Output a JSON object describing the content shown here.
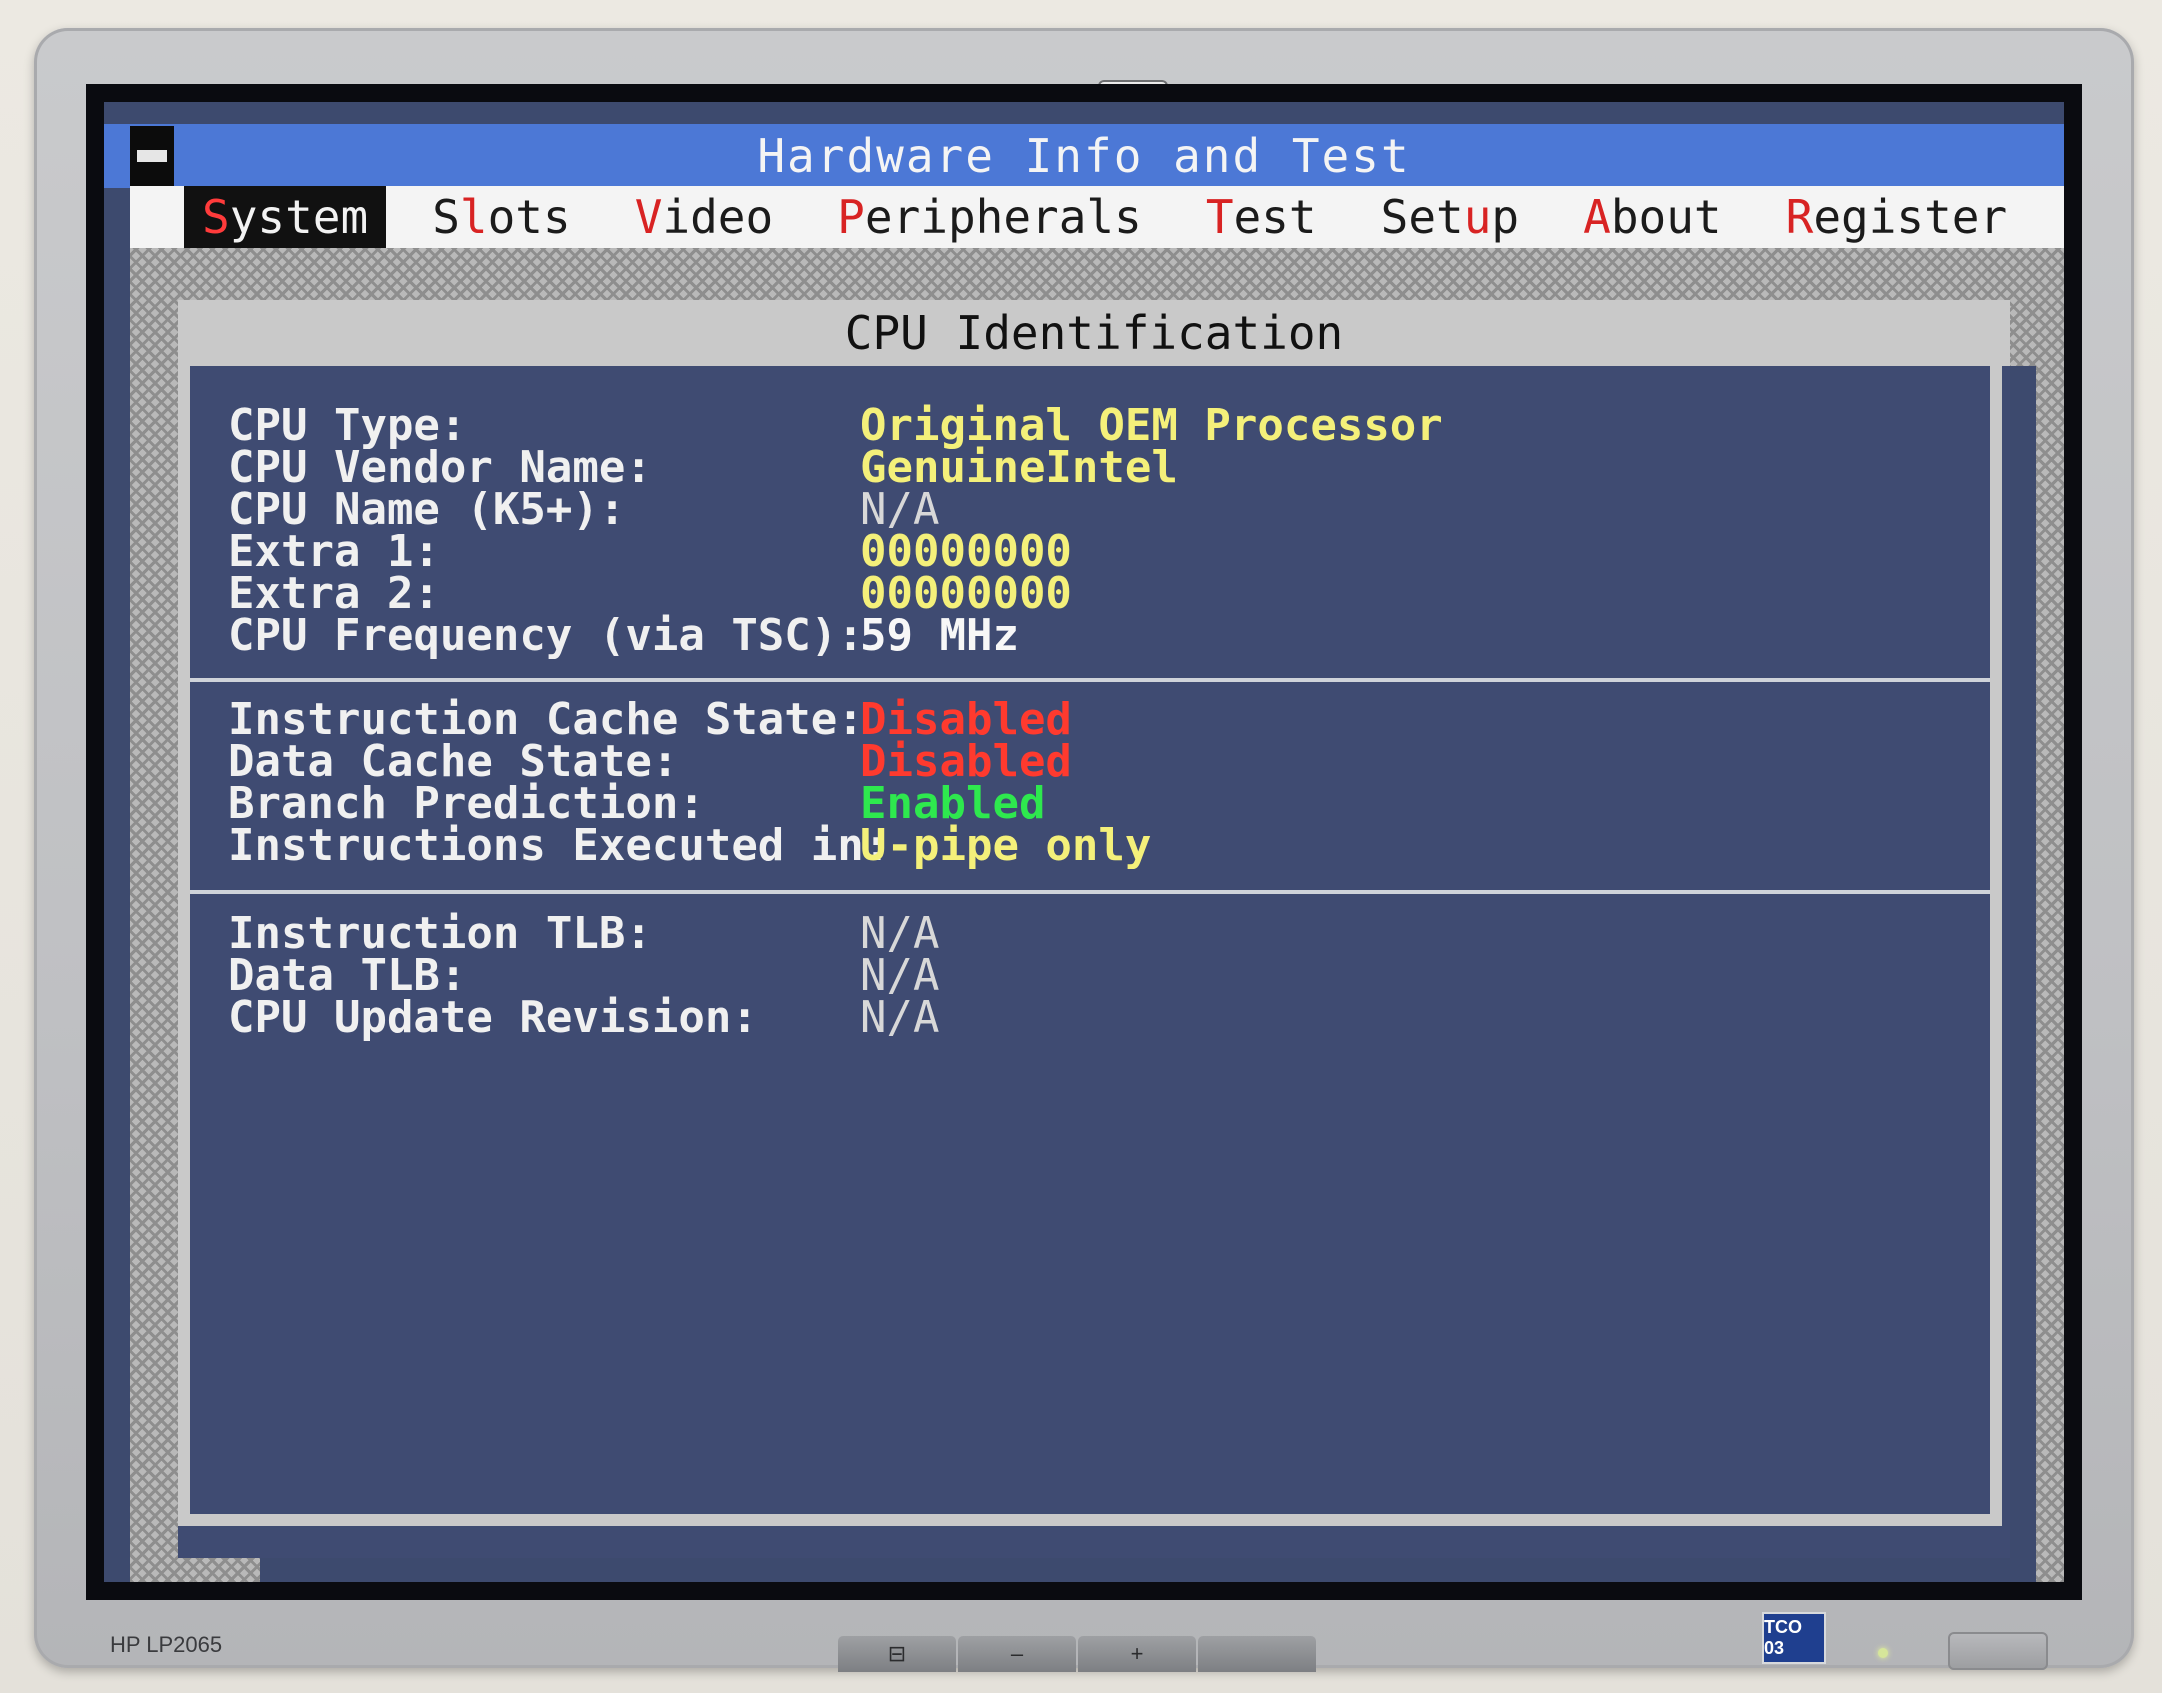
{
  "app": {
    "title": "Hardware Info and Test"
  },
  "menu": {
    "items": [
      {
        "hot": "S",
        "rest": "ystem",
        "active": true
      },
      {
        "hot": "",
        "pre": "S",
        "hotMid": "l",
        "rest": "ots",
        "active": false
      },
      {
        "hot": "V",
        "rest": "ideo",
        "active": false
      },
      {
        "hot": "P",
        "rest": "eripherals",
        "active": false
      },
      {
        "hot": "T",
        "rest": "est",
        "active": false
      },
      {
        "hot": "",
        "pre": "Set",
        "hotMid": "u",
        "rest": "p",
        "active": false
      },
      {
        "hot": "A",
        "rest": "bout",
        "active": false
      },
      {
        "hot": "R",
        "rest": "egister",
        "active": false
      }
    ]
  },
  "dialog": {
    "title": "CPU Identification",
    "section1": [
      {
        "label": "CPU Type:",
        "value": "Original OEM Processor",
        "color": "yellow"
      },
      {
        "label": "CPU Vendor Name:",
        "value": "GenuineIntel",
        "color": "yellow"
      },
      {
        "label": "CPU Name (K5+):",
        "value": "N/A",
        "color": "gray"
      },
      {
        "label": "Extra 1:",
        "value": "00000000",
        "color": "yellow"
      },
      {
        "label": "Extra 2:",
        "value": "00000000",
        "color": "yellow"
      },
      {
        "label": "CPU Frequency (via TSC):",
        "value": "59 MHz",
        "color": "white"
      }
    ],
    "section2": [
      {
        "label": "Instruction Cache State:",
        "value": "Disabled",
        "color": "red"
      },
      {
        "label": "Data Cache State:",
        "value": "Disabled",
        "color": "red"
      },
      {
        "label": "Branch Prediction:",
        "value": "Enabled",
        "color": "green"
      },
      {
        "label": "Instructions Executed in:",
        "value": "U-pipe only",
        "color": "yellow"
      }
    ],
    "section3": [
      {
        "label": "Instruction TLB:",
        "value": "N/A",
        "color": "gray"
      },
      {
        "label": "Data TLB:",
        "value": "N/A",
        "color": "gray"
      },
      {
        "label": "CPU Update Revision:",
        "value": "N/A",
        "color": "gray"
      }
    ]
  },
  "bezel": {
    "model": "HP LP2065",
    "brand_logo": "hp",
    "buttons": [
      "⊟",
      "–",
      "+",
      ""
    ],
    "badge": "TCO 03"
  },
  "colors": {
    "screen_bg": "#3d4a6e",
    "titlebar": "#4c78d6",
    "value_yellow": "#f4f07a",
    "value_red": "#ff3a2e",
    "value_green": "#2ee84e"
  }
}
